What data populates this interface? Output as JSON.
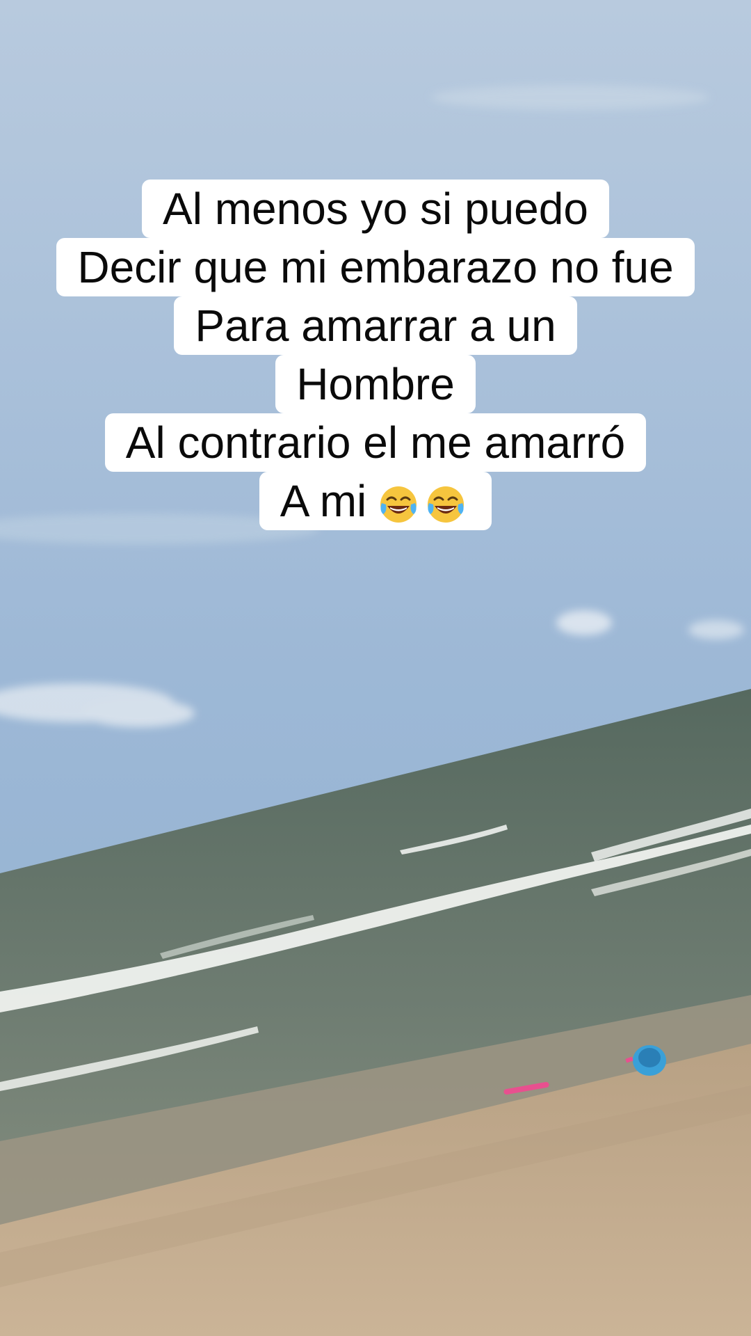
{
  "caption": {
    "lines": [
      "Al menos yo si puedo",
      "Decir que mi embarazo no fue",
      "Para amarrar a un",
      "Hombre",
      "Al contrario el me amarró",
      "A mi"
    ],
    "emoji": [
      "face-with-tears-of-joy-icon",
      "face-with-tears-of-joy-icon"
    ]
  },
  "scene": {
    "description_items": [
      "sky",
      "clouds",
      "sea",
      "waves",
      "wet-sand",
      "dry-sand",
      "toy-bucket",
      "toy-shovel"
    ],
    "colors": {
      "sky_top": "#b6c9de",
      "sky_bottom": "#8fb0d3",
      "sea_far": "#5b6f6a",
      "sea_near": "#8a9488",
      "foam": "#f2f4f1",
      "sand": "#c8b092",
      "wet_sand": "#a39580",
      "bucket": "#3aa0d8",
      "shovel": "#e8508f"
    }
  }
}
